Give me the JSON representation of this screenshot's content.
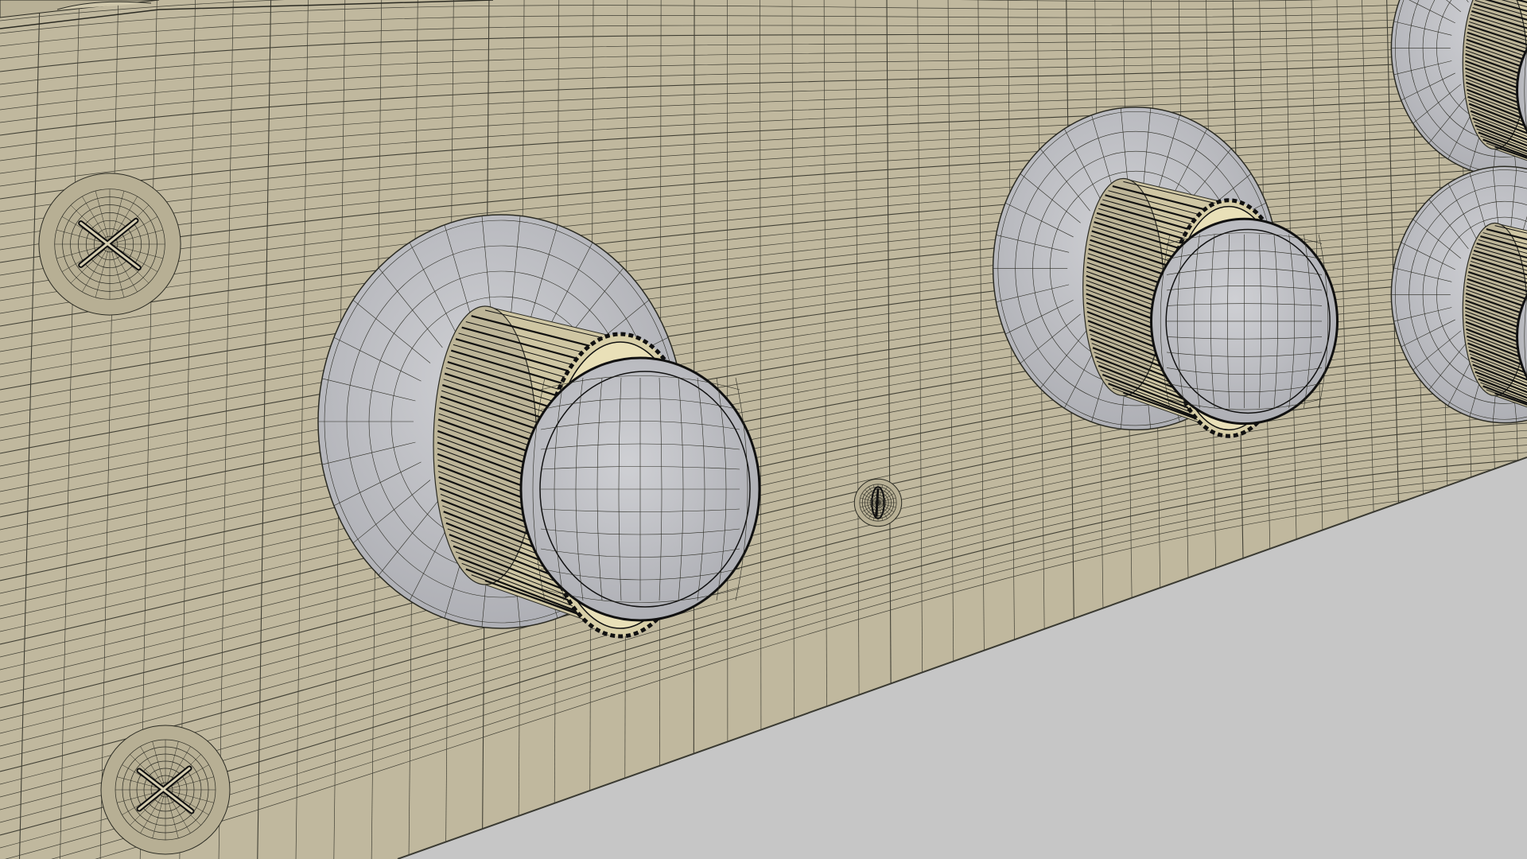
{
  "scene": {
    "subject": "wireframe-render",
    "colors": {
      "panel": "#c0b89e",
      "panel_edge": "#a79f86",
      "wire": "#2a2a22",
      "metal": "#bfc0c4",
      "metal_dark": "#9ea0a6",
      "knob_shadow": "#101010",
      "floor": "#c6c6c6",
      "highlight": "#e9e0b8"
    },
    "objects": [
      {
        "kind": "panel",
        "icon": "panel-face"
      },
      {
        "kind": "knob",
        "icon": "knurled-knob-icon",
        "count": 2
      },
      {
        "kind": "knob-partial",
        "icon": "knurled-knob-icon",
        "count": 2
      },
      {
        "kind": "screw",
        "icon": "phillips-screw-icon",
        "count": 2
      },
      {
        "kind": "screw-small",
        "icon": "slotted-screw-icon",
        "count": 1
      },
      {
        "kind": "floor",
        "icon": "ground-plane"
      }
    ]
  }
}
